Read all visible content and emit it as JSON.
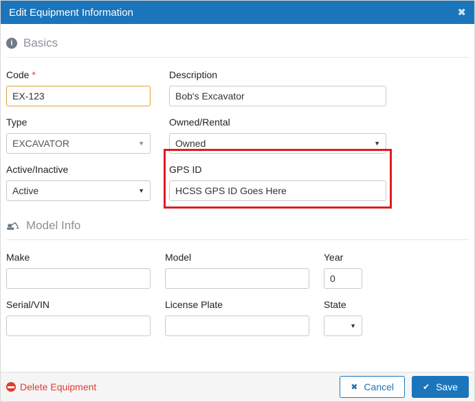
{
  "modal": {
    "title": "Edit Equipment Information"
  },
  "icons": {
    "close": "✖",
    "info": "i",
    "caret": "▼",
    "cancel_x": "✖",
    "save_check": "✔"
  },
  "basics": {
    "title": "Basics",
    "code": {
      "label": "Code",
      "required_mark": "*",
      "value": "EX-123"
    },
    "description": {
      "label": "Description",
      "value": "Bob's Excavator"
    },
    "type": {
      "label": "Type",
      "value": "EXCAVATOR"
    },
    "owned_rental": {
      "label": "Owned/Rental",
      "value": "Owned"
    },
    "active_inactive": {
      "label": "Active/Inactive",
      "value": "Active"
    },
    "gps_id": {
      "label": "GPS ID",
      "value": "HCSS GPS ID Goes Here"
    }
  },
  "model_info": {
    "title": "Model Info",
    "make": {
      "label": "Make",
      "value": ""
    },
    "model": {
      "label": "Model",
      "value": ""
    },
    "year": {
      "label": "Year",
      "value": "0"
    },
    "serial_vin": {
      "label": "Serial/VIN",
      "value": ""
    },
    "license_plate": {
      "label": "License Plate",
      "value": ""
    },
    "state": {
      "label": "State",
      "value": ""
    }
  },
  "footer": {
    "delete_label": "Delete Equipment",
    "cancel_label": "Cancel",
    "save_label": "Save"
  },
  "colors": {
    "header_blue": "#1b75bb",
    "delete_red": "#e03c31",
    "annotation_red": "#dd1b21",
    "focus_border_orange": "#e0a030"
  }
}
